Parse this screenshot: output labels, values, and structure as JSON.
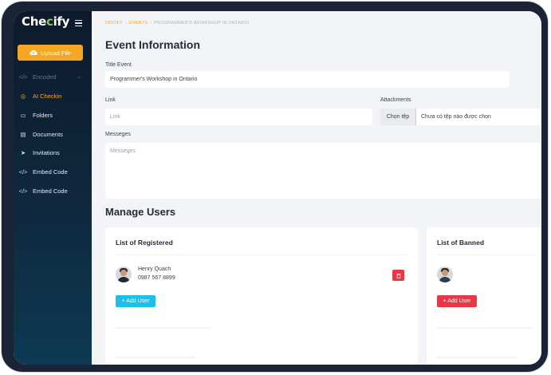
{
  "sidebar": {
    "logo": {
      "prefix": "Che",
      "check": "c",
      "suffix": "ify"
    },
    "upload_label": "Upload File",
    "items": [
      {
        "icon": "code-icon",
        "glyph": "</>",
        "label": "Encoded",
        "state": "disabled"
      },
      {
        "icon": "camera-icon",
        "glyph": "◎",
        "label": "AI Checkin",
        "state": "active"
      },
      {
        "icon": "folder-icon",
        "glyph": "▭",
        "label": "Folders",
        "state": "normal"
      },
      {
        "icon": "document-icon",
        "glyph": "▤",
        "label": "Documents",
        "state": "normal"
      },
      {
        "icon": "send-icon",
        "glyph": "➤",
        "label": "Invitations",
        "state": "normal"
      },
      {
        "icon": "code-icon",
        "glyph": "</>",
        "label": "Embed Code",
        "state": "normal"
      },
      {
        "icon": "code-icon",
        "glyph": "</>",
        "label": "Embed Code",
        "state": "normal"
      }
    ]
  },
  "breadcrumb": [
    "DOCIFY",
    "EVENTS",
    "PROGRAMMER'S WORKSHOP IN ONTARIO"
  ],
  "page_title": "Event Information",
  "form": {
    "title_label": "Title Event",
    "title_value": "Programmer's Workshop in Ontario",
    "link_label": "Link",
    "link_placeholder": "Link",
    "attachments_label": "Attackments",
    "file_button": "Chọn tệp",
    "file_status": "Chưa có tệp nào được chọn",
    "messages_label": "Messeges",
    "messages_placeholder": "Messeges"
  },
  "manage_users": {
    "title": "Manage Users",
    "registered": {
      "title": "List of Registered",
      "users": [
        {
          "name": "Henry Quach",
          "phone": "0987 567 8899"
        }
      ],
      "add_label": "+ Add User"
    },
    "banned": {
      "title": "List of Banned",
      "add_label": "+ Add User"
    }
  },
  "colors": {
    "accent": "#f5a623",
    "info": "#1cc0e8",
    "danger": "#e53947",
    "sidebar": "#0d1a2c"
  }
}
